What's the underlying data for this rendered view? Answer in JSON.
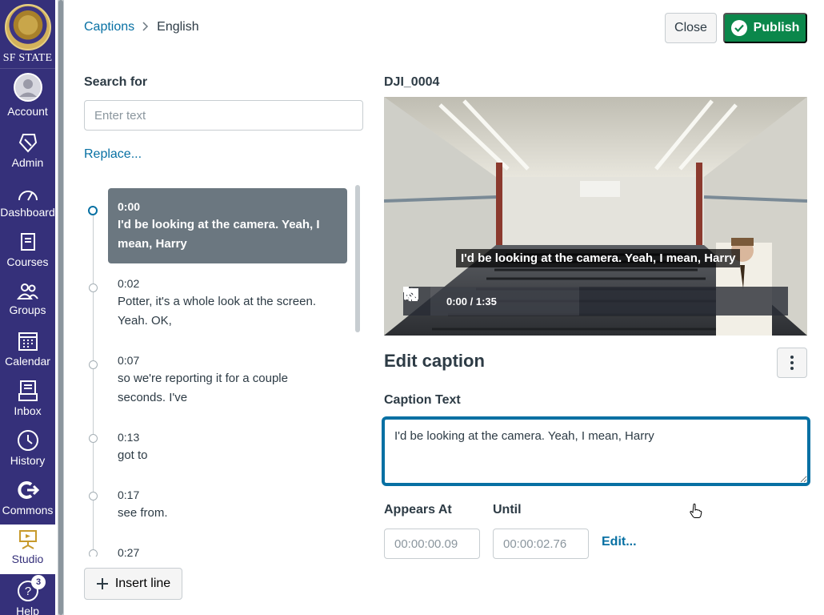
{
  "nav": {
    "logo_text": "SF STATE",
    "items": [
      {
        "label": "Account",
        "icon": "avatar-icon"
      },
      {
        "label": "Admin",
        "icon": "shield-icon"
      },
      {
        "label": "Dashboard",
        "icon": "dashboard-icon"
      },
      {
        "label": "Courses",
        "icon": "book-icon"
      },
      {
        "label": "Groups",
        "icon": "groups-icon"
      },
      {
        "label": "Calendar",
        "icon": "calendar-icon"
      },
      {
        "label": "Inbox",
        "icon": "inbox-icon"
      },
      {
        "label": "History",
        "icon": "clock-icon"
      },
      {
        "label": "Commons",
        "icon": "commons-icon"
      },
      {
        "label": "Studio",
        "icon": "studio-icon"
      },
      {
        "label": "Help",
        "icon": "help-icon",
        "badge": "3"
      }
    ],
    "active": "Studio",
    "colors": {
      "nav_bg": "#35307a",
      "active_bg": "#ffffff"
    }
  },
  "breadcrumb": {
    "root": "Captions",
    "current": "English"
  },
  "header": {
    "close_label": "Close",
    "publish_label": "Publish"
  },
  "search": {
    "label": "Search for",
    "placeholder": "Enter text",
    "replace_label": "Replace..."
  },
  "captions": [
    {
      "time": "0:00",
      "text": "I'd be looking at the camera. Yeah, I mean, Harry",
      "selected": true
    },
    {
      "time": "0:02",
      "text": "Potter, it's a whole look at the screen. Yeah. OK,"
    },
    {
      "time": "0:07",
      "text": "so we're reporting it for a couple seconds. I've"
    },
    {
      "time": "0:13",
      "text": "got to"
    },
    {
      "time": "0:17",
      "text": "see from."
    },
    {
      "time": "0:27",
      "text": ""
    }
  ],
  "insert_label": "Insert line",
  "video": {
    "title": "DJI_0004",
    "subtitle": "I'd be looking at the camera. Yeah, I mean, Harry",
    "time": "0:00 / 1:35"
  },
  "editor": {
    "title": "Edit caption",
    "caption_label": "Caption Text",
    "caption_value": "I'd be looking at the camera. Yeah, I mean, Harry",
    "appears_label": "Appears At",
    "until_label": "Until",
    "appears_value": "00:00:00.09",
    "until_value": "00:00:02.76",
    "edit_label": "Edit..."
  },
  "colors": {
    "accent": "#0770a3",
    "publish": "#0b874b",
    "selected_caption": "#6b7780"
  }
}
